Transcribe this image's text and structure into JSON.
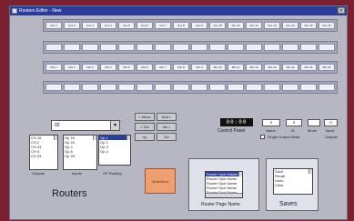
{
  "window": {
    "title": "Routers Editor - New"
  },
  "rows": [
    {
      "cells": [
        "Aux 1",
        "Aux 2",
        "Aux 3",
        "Aux 4",
        "Aux 5",
        "Aux 6",
        "Aux 7",
        "Aux 8",
        "Aux 9",
        "Aux 10",
        "Aux 11",
        "Aux 12",
        "Aux 13",
        "Aux 14",
        "Aux 15",
        "Aux 16"
      ]
    },
    {
      "cells": [
        "",
        "",
        "",
        "",
        "",
        "",
        "",
        "",
        "",
        "",
        "",
        "",
        "",
        "",
        "",
        ""
      ]
    },
    {
      "cells": [
        "Mix 1",
        "Mix 2",
        "Mix 3",
        "Mix 4",
        "Mix 5",
        "Mix 6",
        "Mix 7",
        "Mix 8",
        "Mix 9",
        "Mix 10",
        "Mix 11",
        "Mix 12",
        "Mix 13",
        "Mix 14",
        "Mix 15",
        "Mix 16"
      ]
    },
    {
      "cells": [
        "",
        "",
        "",
        "",
        "",
        "",
        "",
        "",
        "",
        "",
        "",
        "",
        "",
        "",
        "",
        ""
      ]
    }
  ],
  "router_select": {
    "value": "02"
  },
  "control_panel": {
    "display": "00:00",
    "label": "Control Panel"
  },
  "fields": {
    "label_1": "Name",
    "label_2": "ID",
    "label_3": "Mode",
    "label_4": "Input",
    "value_1": "0",
    "value_2": "0",
    "value_3": "",
    "value_4": "0"
  },
  "checkbox": {
    "label": "Single Output Mode"
  },
  "right_label": {
    "text": "Outputs"
  },
  "lists": {
    "left": [
      "CH 16",
      "CH 2",
      "CH 24",
      "CH 4",
      "CH 33"
    ],
    "middle": [
      "Op 16",
      "Op 24",
      "Op 4",
      "Op 8",
      "Op 25"
    ],
    "right": [
      "Op 1",
      "Op 2",
      "Op 3",
      "Op 4"
    ],
    "left_caption": "Outputs",
    "middle_caption": "Inputs",
    "right_caption": "OP Routing"
  },
  "buttons": {
    "b1": "< Move",
    "b2": "Add >",
    "b3": "< Del",
    "b4": "Ins >",
    "b5": "Up",
    "b6": "Dn"
  },
  "routers_label": "Routers",
  "orange_button": "Mute/Mod",
  "rpn": {
    "items": [
      "Router Spot Master",
      "Router Spot Name",
      "Router Spot Name",
      "Router Spot Name",
      "Router Spot Name"
    ],
    "label": "Router Page Name"
  },
  "saves": {
    "items": [
      "Save",
      "Recall",
      "Undo",
      "Clear"
    ],
    "label": "Saves"
  },
  "colors": {
    "accent": "#2b3c9a",
    "orange": "#f0a070",
    "desktop": "#7a2030"
  }
}
